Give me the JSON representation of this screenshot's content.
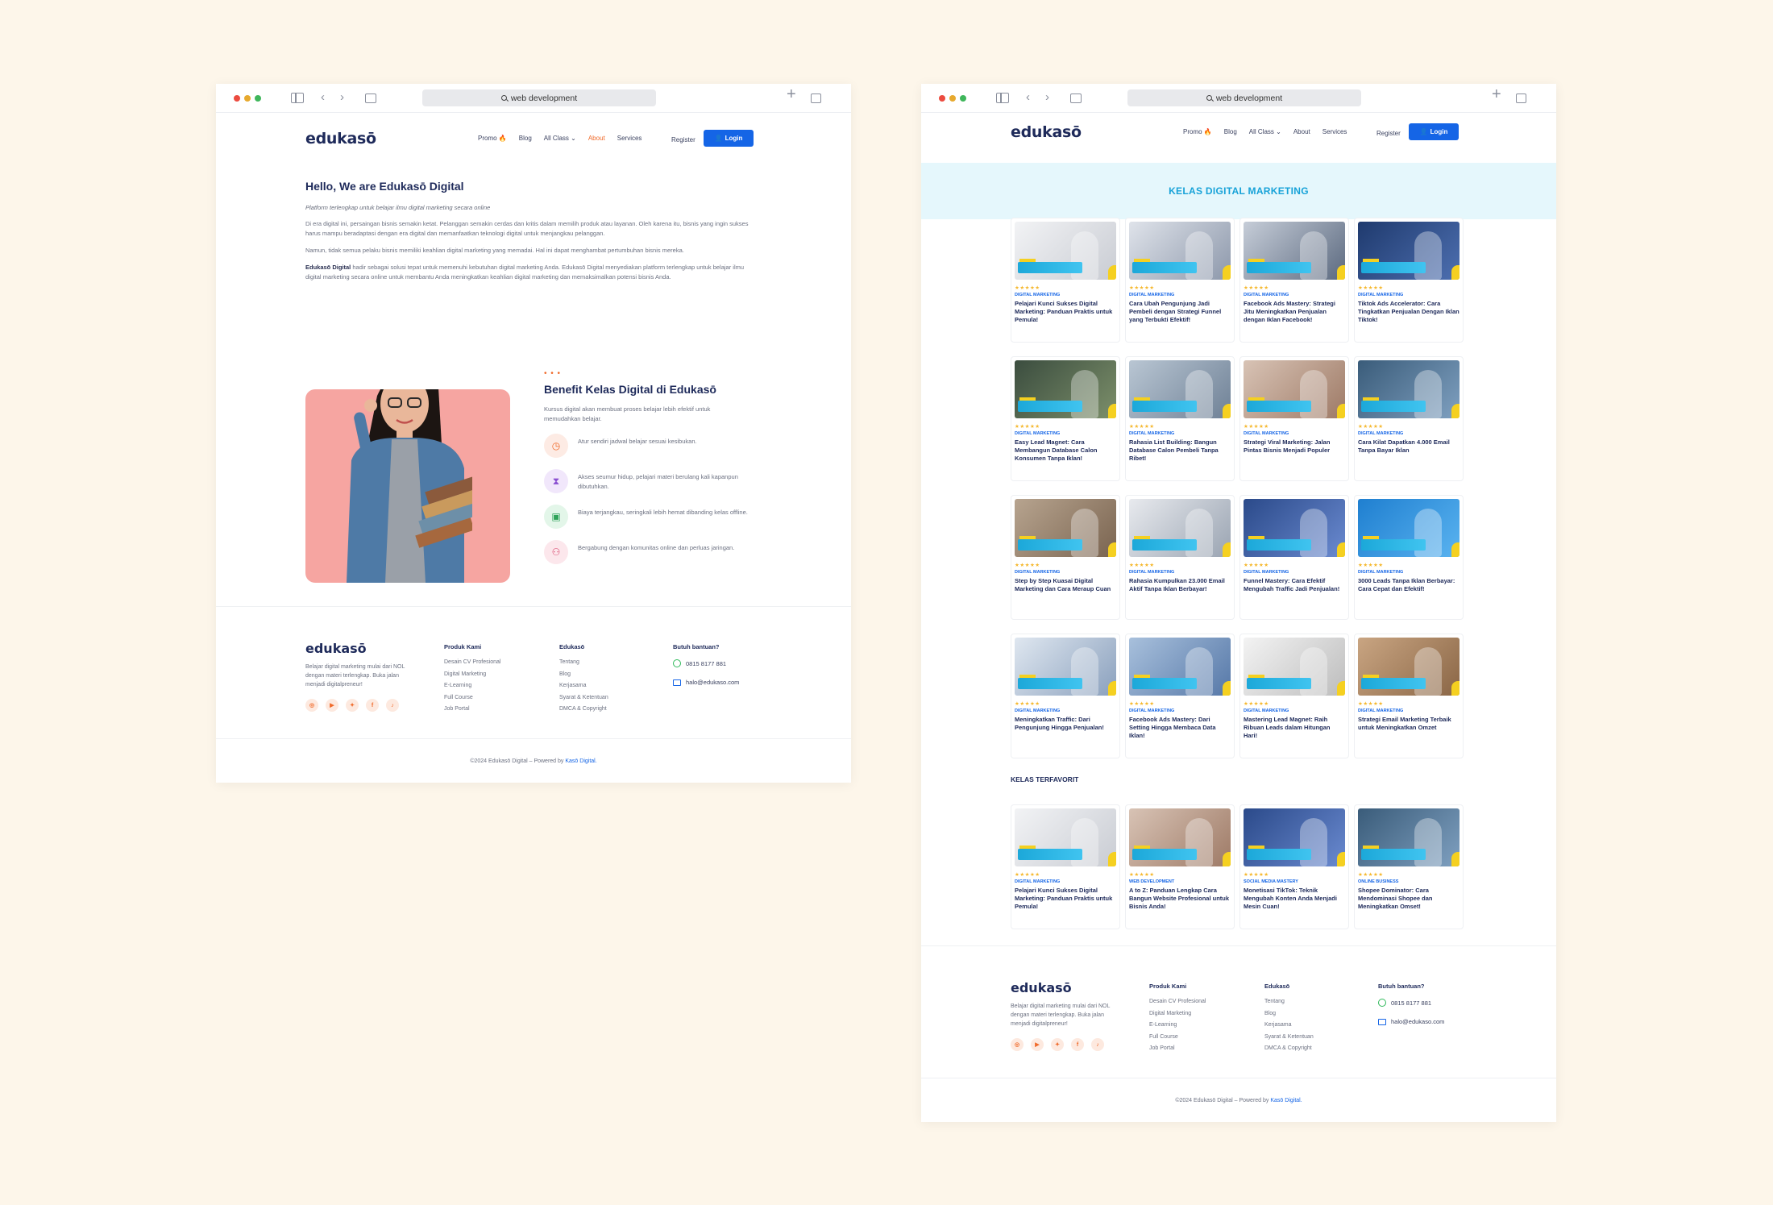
{
  "browser": {
    "address": "web development"
  },
  "nav": {
    "logo": "edukasō",
    "items": [
      "Promo",
      "Blog",
      "All Class",
      "About",
      "Services"
    ],
    "register": "Register",
    "login": "Login"
  },
  "about": {
    "title": "Hello, We are Edukasō Digital",
    "tagline": "Platform terlengkap untuk belajar ilmu digital marketing secara online",
    "p1": "Di era digital ini, persaingan bisnis semakin ketat. Pelanggan semakin cerdas dan kritis dalam memilih produk atau layanan. Oleh karena itu, bisnis yang ingin sukses harus mampu beradaptasi dengan era digital dan memanfaatkan teknologi digital untuk menjangkau pelanggan.",
    "p2": "Namun, tidak semua pelaku bisnis memiliki keahlian digital marketing yang memadai. Hal ini dapat menghambat pertumbuhan bisnis mereka.",
    "p3_bold": "Edukasō Digital",
    "p3": " hadir sebagai solusi tepat untuk memenuhi kebutuhan digital marketing Anda. Edukasō Digital menyediakan platform terlengkap untuk belajar ilmu digital marketing secara online untuk membantu Anda meningkatkan keahlian digital marketing dan memaksimalkan potensi bisnis Anda."
  },
  "benefit": {
    "title": "Benefit Kelas Digital di Edukasō",
    "desc": "Kursus digital akan membuat proses belajar lebih efektif untuk memudahkan belajar.",
    "items": [
      {
        "icon": "clock-icon",
        "text": "Atur sendiri jadwal belajar sesuai kesibukan."
      },
      {
        "icon": "hourglass-icon",
        "text": "Akses seumur hidup, pelajari materi berulang kali kapanpun dibutuhkan."
      },
      {
        "icon": "wallet-icon",
        "text": "Biaya terjangkau, seringkali lebih hemat dibanding kelas offline."
      },
      {
        "icon": "community-icon",
        "text": "Bergabung dengan komunitas online dan perluas jaringan."
      }
    ]
  },
  "footer": {
    "logo": "edukasō",
    "desc": "Belajar digital marketing mulai dari NOL dengan materi terlengkap. Buka jalan menjadi digitalpreneur!",
    "col1": {
      "title": "Produk Kami",
      "items": [
        "Desain CV Profesional",
        "Digital Marketing",
        "E-Learning",
        "Full Course",
        "Job Portal"
      ]
    },
    "col2": {
      "title": "Edukasō",
      "items": [
        "Tentang",
        "Blog",
        "Kerjasama",
        "Syarat & Ketentuan",
        "DMCA & Copyright"
      ]
    },
    "col3": {
      "title": "Butuh bantuan?",
      "phone": "0815 8177 881",
      "email": "halo@edukaso.com"
    },
    "copyright_prefix": "©2024 Edukasō Digital – Powered by ",
    "copyright_link": "Kasō Digital."
  },
  "class_page": {
    "banner": "KELAS DIGITAL MARKETING",
    "favorite_label": "KELAS TERFAVORIT",
    "rating": "★★★★★",
    "courses": [
      {
        "cat": "DIGITAL MARKETING",
        "title": "Pelajari Kunci Sukses Digital Marketing: Panduan Praktis untuk Pemula!"
      },
      {
        "cat": "DIGITAL MARKETING",
        "title": "Cara Ubah Pengunjung Jadi Pembeli dengan Strategi Funnel yang Terbukti Efektif!"
      },
      {
        "cat": "DIGITAL MARKETING",
        "title": "Facebook Ads Mastery: Strategi Jitu Meningkatkan Penjualan dengan Iklan Facebook!"
      },
      {
        "cat": "DIGITAL MARKETING",
        "title": "Tiktok Ads Accelerator: Cara Tingkatkan Penjualan Dengan Iklan Tiktok!"
      },
      {
        "cat": "DIGITAL MARKETING",
        "title": "Easy Lead Magnet: Cara Membangun Database Calon Konsumen Tanpa Iklan!"
      },
      {
        "cat": "DIGITAL MARKETING",
        "title": "Rahasia List Building: Bangun Database Calon Pembeli Tanpa Ribet!"
      },
      {
        "cat": "DIGITAL MARKETING",
        "title": "Strategi Viral Marketing: Jalan Pintas Bisnis Menjadi Populer"
      },
      {
        "cat": "DIGITAL MARKETING",
        "title": "Cara Kilat Dapatkan 4.000 Email Tanpa Bayar Iklan"
      },
      {
        "cat": "DIGITAL MARKETING",
        "title": "Step by Step Kuasai Digital Marketing dan Cara Meraup Cuan"
      },
      {
        "cat": "DIGITAL MARKETING",
        "title": "Rahasia Kumpulkan 23.000 Email Aktif Tanpa Iklan Berbayar!"
      },
      {
        "cat": "DIGITAL MARKETING",
        "title": "Funnel Mastery: Cara Efektif Mengubah Traffic Jadi Penjualan!"
      },
      {
        "cat": "DIGITAL MARKETING",
        "title": "3000 Leads Tanpa Iklan Berbayar: Cara Cepat dan Efektif!"
      },
      {
        "cat": "DIGITAL MARKETING",
        "title": "Meningkatkan Traffic: Dari Pengunjung Hingga Penjualan!"
      },
      {
        "cat": "DIGITAL MARKETING",
        "title": "Facebook Ads Mastery: Dari Setting Hingga Membaca Data Iklan!"
      },
      {
        "cat": "DIGITAL MARKETING",
        "title": "Mastering Lead Magnet: Raih Ribuan Leads dalam Hitungan Hari!"
      },
      {
        "cat": "DIGITAL MARKETING",
        "title": "Strategi Email Marketing Terbaik untuk Meningkatkan Omzet"
      }
    ],
    "favorites": [
      {
        "cat": "DIGITAL MARKETING",
        "title": "Pelajari Kunci Sukses Digital Marketing: Panduan Praktis untuk Pemula!"
      },
      {
        "cat": "WEB DEVELOPMENT",
        "title": "A to Z: Panduan Lengkap Cara Bangun Website Profesional untuk Bisnis Anda!"
      },
      {
        "cat": "SOCIAL MEDIA MASTERY",
        "title": "Monetisasi TikTok: Teknik Mengubah Konten Anda Menjadi Mesin Cuan!"
      },
      {
        "cat": "ONLINE BUSINESS",
        "title": "Shopee Dominator: Cara Mendominasi Shopee dan Meningkatkan Omset!"
      }
    ]
  },
  "colors": {
    "accent": "#1565e6",
    "orange": "#f06a2a",
    "navy": "#1e2a5a",
    "banner_bg": "#e5f7fc",
    "banner_text": "#17a2d8"
  }
}
